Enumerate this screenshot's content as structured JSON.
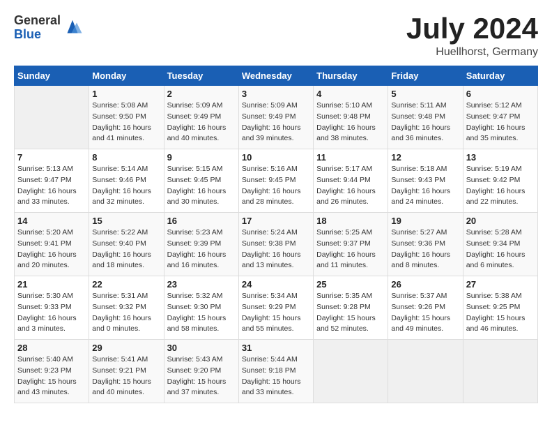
{
  "header": {
    "logo_general": "General",
    "logo_blue": "Blue",
    "title": "July 2024",
    "location": "Huellhorst, Germany"
  },
  "weekdays": [
    "Sunday",
    "Monday",
    "Tuesday",
    "Wednesday",
    "Thursday",
    "Friday",
    "Saturday"
  ],
  "weeks": [
    [
      {
        "day": "",
        "empty": true
      },
      {
        "day": "1",
        "sunrise": "Sunrise: 5:08 AM",
        "sunset": "Sunset: 9:50 PM",
        "daylight": "Daylight: 16 hours and 41 minutes."
      },
      {
        "day": "2",
        "sunrise": "Sunrise: 5:09 AM",
        "sunset": "Sunset: 9:49 PM",
        "daylight": "Daylight: 16 hours and 40 minutes."
      },
      {
        "day": "3",
        "sunrise": "Sunrise: 5:09 AM",
        "sunset": "Sunset: 9:49 PM",
        "daylight": "Daylight: 16 hours and 39 minutes."
      },
      {
        "day": "4",
        "sunrise": "Sunrise: 5:10 AM",
        "sunset": "Sunset: 9:48 PM",
        "daylight": "Daylight: 16 hours and 38 minutes."
      },
      {
        "day": "5",
        "sunrise": "Sunrise: 5:11 AM",
        "sunset": "Sunset: 9:48 PM",
        "daylight": "Daylight: 16 hours and 36 minutes."
      },
      {
        "day": "6",
        "sunrise": "Sunrise: 5:12 AM",
        "sunset": "Sunset: 9:47 PM",
        "daylight": "Daylight: 16 hours and 35 minutes."
      }
    ],
    [
      {
        "day": "7",
        "sunrise": "Sunrise: 5:13 AM",
        "sunset": "Sunset: 9:47 PM",
        "daylight": "Daylight: 16 hours and 33 minutes."
      },
      {
        "day": "8",
        "sunrise": "Sunrise: 5:14 AM",
        "sunset": "Sunset: 9:46 PM",
        "daylight": "Daylight: 16 hours and 32 minutes."
      },
      {
        "day": "9",
        "sunrise": "Sunrise: 5:15 AM",
        "sunset": "Sunset: 9:45 PM",
        "daylight": "Daylight: 16 hours and 30 minutes."
      },
      {
        "day": "10",
        "sunrise": "Sunrise: 5:16 AM",
        "sunset": "Sunset: 9:45 PM",
        "daylight": "Daylight: 16 hours and 28 minutes."
      },
      {
        "day": "11",
        "sunrise": "Sunrise: 5:17 AM",
        "sunset": "Sunset: 9:44 PM",
        "daylight": "Daylight: 16 hours and 26 minutes."
      },
      {
        "day": "12",
        "sunrise": "Sunrise: 5:18 AM",
        "sunset": "Sunset: 9:43 PM",
        "daylight": "Daylight: 16 hours and 24 minutes."
      },
      {
        "day": "13",
        "sunrise": "Sunrise: 5:19 AM",
        "sunset": "Sunset: 9:42 PM",
        "daylight": "Daylight: 16 hours and 22 minutes."
      }
    ],
    [
      {
        "day": "14",
        "sunrise": "Sunrise: 5:20 AM",
        "sunset": "Sunset: 9:41 PM",
        "daylight": "Daylight: 16 hours and 20 minutes."
      },
      {
        "day": "15",
        "sunrise": "Sunrise: 5:22 AM",
        "sunset": "Sunset: 9:40 PM",
        "daylight": "Daylight: 16 hours and 18 minutes."
      },
      {
        "day": "16",
        "sunrise": "Sunrise: 5:23 AM",
        "sunset": "Sunset: 9:39 PM",
        "daylight": "Daylight: 16 hours and 16 minutes."
      },
      {
        "day": "17",
        "sunrise": "Sunrise: 5:24 AM",
        "sunset": "Sunset: 9:38 PM",
        "daylight": "Daylight: 16 hours and 13 minutes."
      },
      {
        "day": "18",
        "sunrise": "Sunrise: 5:25 AM",
        "sunset": "Sunset: 9:37 PM",
        "daylight": "Daylight: 16 hours and 11 minutes."
      },
      {
        "day": "19",
        "sunrise": "Sunrise: 5:27 AM",
        "sunset": "Sunset: 9:36 PM",
        "daylight": "Daylight: 16 hours and 8 minutes."
      },
      {
        "day": "20",
        "sunrise": "Sunrise: 5:28 AM",
        "sunset": "Sunset: 9:34 PM",
        "daylight": "Daylight: 16 hours and 6 minutes."
      }
    ],
    [
      {
        "day": "21",
        "sunrise": "Sunrise: 5:30 AM",
        "sunset": "Sunset: 9:33 PM",
        "daylight": "Daylight: 16 hours and 3 minutes."
      },
      {
        "day": "22",
        "sunrise": "Sunrise: 5:31 AM",
        "sunset": "Sunset: 9:32 PM",
        "daylight": "Daylight: 16 hours and 0 minutes."
      },
      {
        "day": "23",
        "sunrise": "Sunrise: 5:32 AM",
        "sunset": "Sunset: 9:30 PM",
        "daylight": "Daylight: 15 hours and 58 minutes."
      },
      {
        "day": "24",
        "sunrise": "Sunrise: 5:34 AM",
        "sunset": "Sunset: 9:29 PM",
        "daylight": "Daylight: 15 hours and 55 minutes."
      },
      {
        "day": "25",
        "sunrise": "Sunrise: 5:35 AM",
        "sunset": "Sunset: 9:28 PM",
        "daylight": "Daylight: 15 hours and 52 minutes."
      },
      {
        "day": "26",
        "sunrise": "Sunrise: 5:37 AM",
        "sunset": "Sunset: 9:26 PM",
        "daylight": "Daylight: 15 hours and 49 minutes."
      },
      {
        "day": "27",
        "sunrise": "Sunrise: 5:38 AM",
        "sunset": "Sunset: 9:25 PM",
        "daylight": "Daylight: 15 hours and 46 minutes."
      }
    ],
    [
      {
        "day": "28",
        "sunrise": "Sunrise: 5:40 AM",
        "sunset": "Sunset: 9:23 PM",
        "daylight": "Daylight: 15 hours and 43 minutes."
      },
      {
        "day": "29",
        "sunrise": "Sunrise: 5:41 AM",
        "sunset": "Sunset: 9:21 PM",
        "daylight": "Daylight: 15 hours and 40 minutes."
      },
      {
        "day": "30",
        "sunrise": "Sunrise: 5:43 AM",
        "sunset": "Sunset: 9:20 PM",
        "daylight": "Daylight: 15 hours and 37 minutes."
      },
      {
        "day": "31",
        "sunrise": "Sunrise: 5:44 AM",
        "sunset": "Sunset: 9:18 PM",
        "daylight": "Daylight: 15 hours and 33 minutes."
      },
      {
        "day": "",
        "empty": true
      },
      {
        "day": "",
        "empty": true
      },
      {
        "day": "",
        "empty": true
      }
    ]
  ]
}
